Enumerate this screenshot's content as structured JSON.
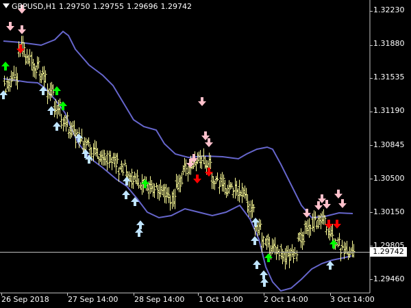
{
  "header": {
    "symbol_timeframe": "GBPUSD,H1",
    "ohlc": [
      "1.29750",
      "1.29755",
      "1.29696",
      "1.29742"
    ]
  },
  "price_axis": {
    "ticks": [
      "1.32230",
      "1.31880",
      "1.31535",
      "1.31190",
      "1.30845",
      "1.30500",
      "1.30150",
      "1.29805",
      "1.29460"
    ]
  },
  "time_axis": {
    "ticks": [
      "26 Sep 2018",
      "27 Sep 14:00",
      "28 Sep 14:00",
      "1 Oct 14:00",
      "2 Oct 14:00",
      "3 Oct 14:00"
    ]
  },
  "current_price": "1.29742",
  "colors": {
    "background": "#000000",
    "candles": "#ffff99",
    "band": "#6666cc",
    "bid_line": "#c0c0c0",
    "arrow_up_light": "#bfe4ff",
    "arrow_down_light": "#ffc0cb",
    "arrow_up_green": "#00ff00",
    "arrow_down_red": "#ff0000",
    "text": "#ffffff"
  },
  "chart_data": {
    "type": "line",
    "series": [
      {
        "values": [
          1.3145,
          1.3155,
          1.3185,
          1.3175,
          1.3165,
          1.3155,
          1.314,
          1.3125,
          1.311,
          1.31,
          1.3092,
          1.3085,
          1.3076,
          1.3072,
          1.307,
          1.3068,
          1.306,
          1.3052,
          1.3048,
          1.3044,
          1.304,
          1.304,
          1.3035,
          1.303,
          1.3045,
          1.306,
          1.3065,
          1.307,
          1.3065,
          1.305,
          1.3045,
          1.304,
          1.3038,
          1.3035,
          1.302,
          1.3,
          1.2985,
          1.2978,
          1.2975,
          1.297,
          1.2972,
          1.299,
          1.3,
          1.3005,
          1.301,
          1.2995,
          1.2985,
          1.2978,
          1.2974
        ]
      }
    ]
  }
}
